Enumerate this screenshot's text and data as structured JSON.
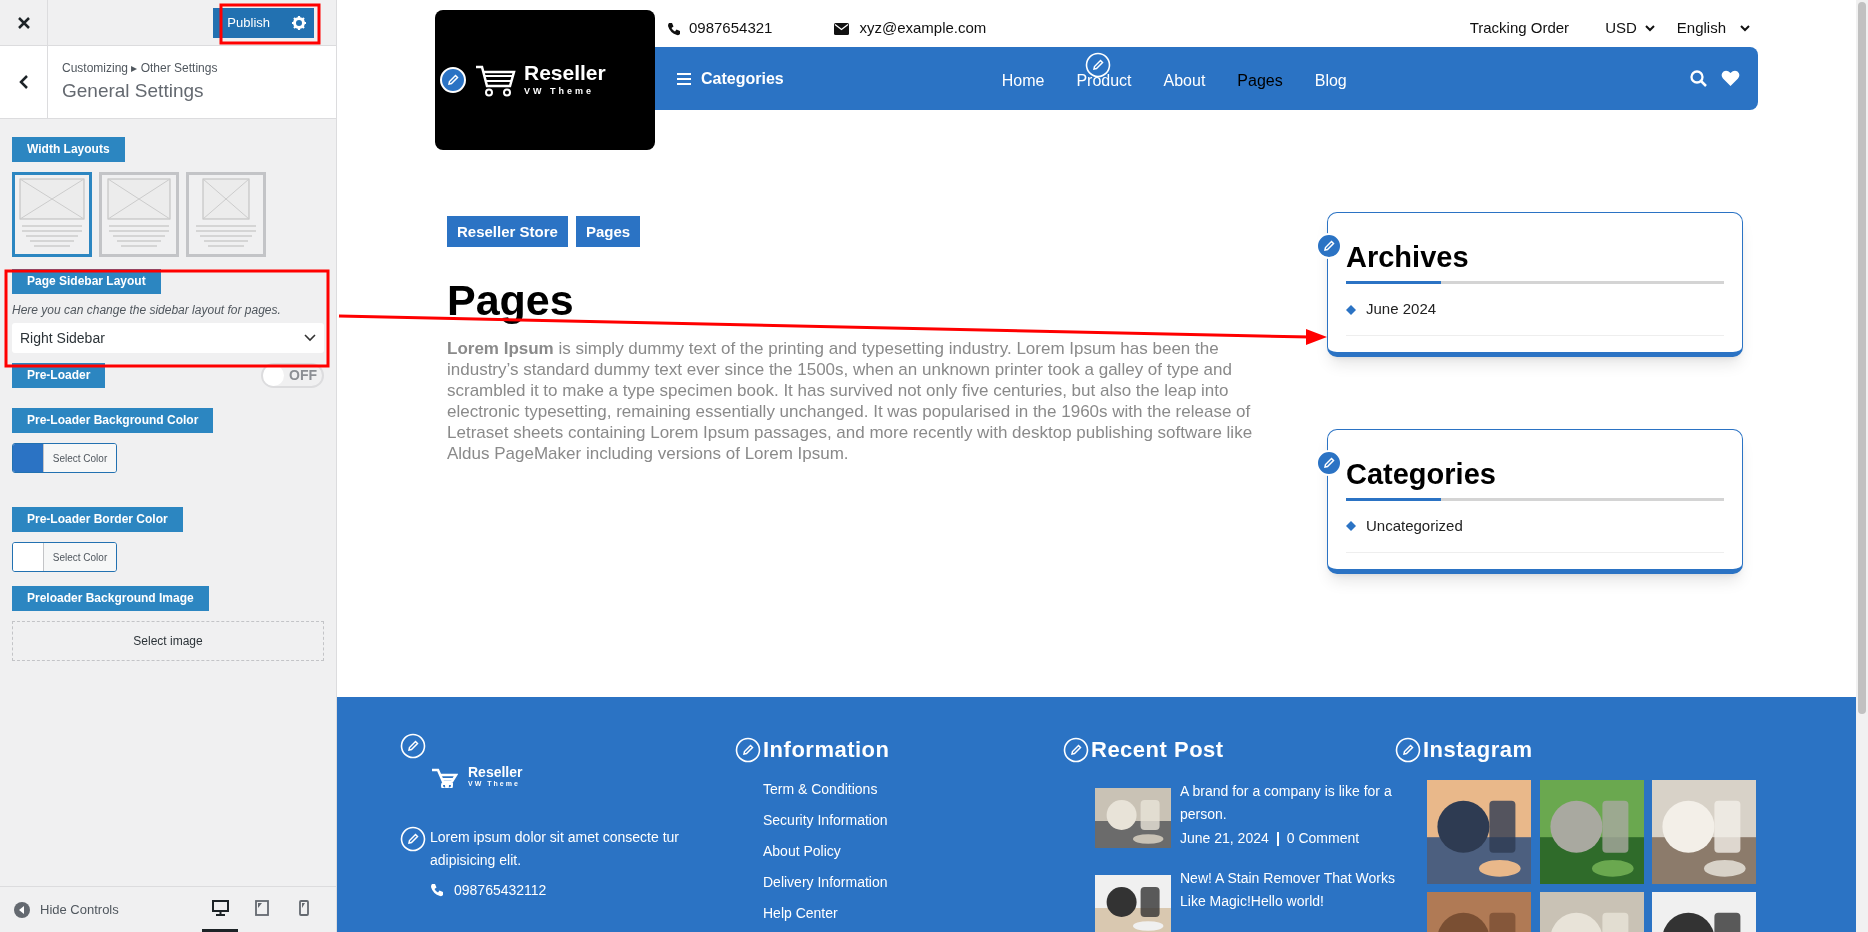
{
  "customizer": {
    "publish_button": "Publish",
    "breadcrumb": "Customizing ▸ Other Settings",
    "section_title": "General Settings",
    "controls": [
      {
        "kind": "layout",
        "label": "Width Layouts",
        "options": [
          {
            "kind": "full",
            "selected": true
          },
          {
            "kind": "boxed",
            "selected": false
          },
          {
            "kind": "narrow",
            "selected": false
          }
        ]
      },
      {
        "kind": "select",
        "label": "Page Sidebar Layout",
        "description": "Here you can change the sidebar layout for pages.",
        "value": "Right Sidebar"
      },
      {
        "kind": "toggle",
        "label": "Pre-Loader",
        "on": false,
        "state_text": "OFF"
      },
      {
        "kind": "color",
        "label": "Pre-Loader Background Color",
        "color": "#2b73c4",
        "button": "Select Color"
      },
      {
        "kind": "color",
        "label": "Pre-Loader Border Color",
        "color": "#ffffff",
        "button": "Select Color"
      },
      {
        "label": "Preloader Background Image",
        "button": "Select image"
      }
    ],
    "bottom_bar": {
      "hide_controls": "Hide Controls",
      "devices": [
        {
          "kind": "desktop",
          "selected": true
        },
        {
          "kind": "tablet",
          "selected": false
        },
        {
          "kind": "mobile",
          "selected": false
        }
      ]
    }
  },
  "site": {
    "topbar": {
      "phone": "0987654321",
      "email": "xyz@example.com",
      "tracking": "Tracking Order",
      "currency": "USD",
      "language": "English"
    },
    "logo": {
      "name": "Reseller",
      "tagline": "VW Theme"
    },
    "nav": {
      "categories": "Categories",
      "items": [
        {
          "label": "Home",
          "selected": false
        },
        {
          "label": "Product",
          "selected": false
        },
        {
          "label": "About",
          "selected": false
        },
        {
          "label": "Pages",
          "selected": true
        },
        {
          "label": "Blog",
          "selected": false
        }
      ]
    },
    "breadcrumbs": [
      "Reseller Store",
      "Pages"
    ],
    "title": "Pages",
    "paragraph": "**Lorem Ipsum** is simply dummy text of the printing and typesetting industry. Lorem Ipsum has been the industry’s standard dummy text ever since the 1500s, when an unknown printer took a galley of type and scrambled it to make a type specimen book. It has survived not only five centuries, but also the leap into electronic typesetting, remaining essentially unchanged. It was popularised in the 1960s with the release of Letraset sheets containing Lorem Ipsum passages, and more recently with desktop publishing software like Aldus PageMaker including versions of Lorem Ipsum.",
    "widgets": [
      {
        "title": "Archives",
        "items": [
          "June 2024"
        ]
      },
      {
        "title": "Categories",
        "items": [
          "Uncategorized"
        ]
      }
    ],
    "footer": {
      "brand": {
        "name": "Reseller",
        "tagline": "VW Theme"
      },
      "about": "Lorem ipsum dolor sit amet consecte tur adipisicing elit.",
      "phone": "098765432112",
      "information": {
        "title": "Information",
        "links": [
          "Term & Conditions",
          "Security Information",
          "About Policy",
          "Delivery Information",
          "Help Center"
        ]
      },
      "recent": {
        "title": "Recent Post",
        "posts": [
          {
            "title": "A brand for a company is like for a person.",
            "date": "June 21, 2024",
            "comments": "0 Comment"
          },
          {
            "title": "New! A Stain Remover That Works Like Magic!Hello world!"
          }
        ]
      },
      "instagram": {
        "title": "Instagram"
      }
    }
  }
}
